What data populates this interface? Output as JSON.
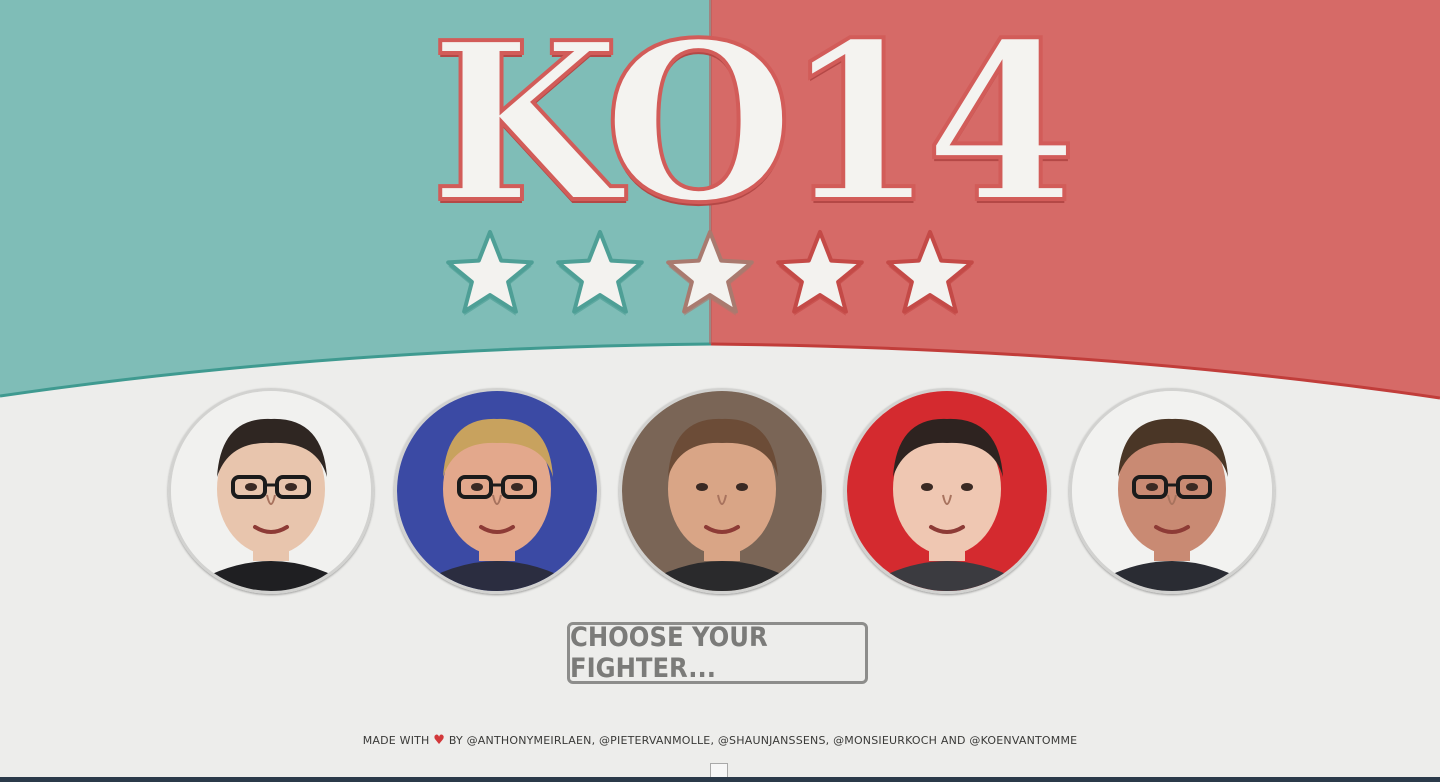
{
  "header": {
    "logo_text": "KO14",
    "star_count": 5,
    "colors": {
      "left": "#7fbdb7",
      "right": "#d66a67",
      "paper": "#ededeb"
    }
  },
  "fighters": [
    {
      "name": "fighter-1",
      "palette": {
        "bg": "#f1f1ef",
        "skin": "#e8c5ad",
        "hair": "#2f2622",
        "suit": "#1f1f22"
      }
    },
    {
      "name": "fighter-2",
      "palette": {
        "bg": "#3b4aa4",
        "skin": "#e3a88c",
        "hair": "#c8a25e",
        "suit": "#2b2d40"
      }
    },
    {
      "name": "fighter-3",
      "palette": {
        "bg": "#7a6556",
        "skin": "#d9a586",
        "hair": "#6c4c37",
        "suit": "#2a2a2c"
      }
    },
    {
      "name": "fighter-4",
      "palette": {
        "bg": "#d42a2f",
        "skin": "#efc7b2",
        "hair": "#2e2320",
        "suit": "#3b3b40"
      }
    },
    {
      "name": "fighter-5",
      "palette": {
        "bg": "#f2f2f0",
        "skin": "#c98a73",
        "hair": "#4a3626",
        "suit": "#2a2c33"
      }
    }
  ],
  "cta": {
    "label": "CHOOSE YOUR FIGHTER..."
  },
  "footer": {
    "made_with": "MADE WITH",
    "by": "BY",
    "contributors": [
      "@ANTHONYMEIRLAEN",
      "@PIETERVANMOLLE",
      "@SHAUNJANSSENS",
      "@MONSIEURKOCH"
    ],
    "and": "AND",
    "last_contributor": "@KOENVANTOMME"
  }
}
